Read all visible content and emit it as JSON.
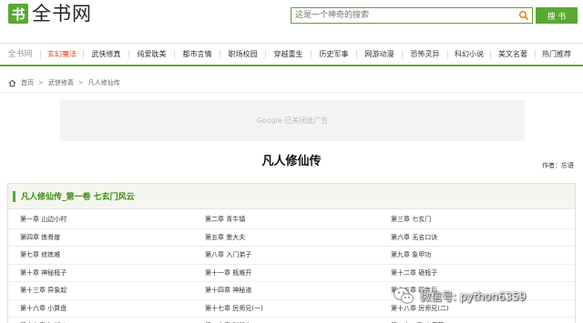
{
  "header": {
    "logo_badge": "书",
    "logo_text": "全书网",
    "search_placeholder": "这是一个神奇的搜索",
    "search_button": "搜 书"
  },
  "nav": {
    "site": "全书网",
    "items": [
      "玄幻魔法",
      "武侠修真",
      "纯爱耽美",
      "都市言情",
      "职场校园",
      "穿越重生",
      "历史军事",
      "网游动漫",
      "恐怖灵异",
      "科幻小说",
      "美文名著",
      "热门推荐"
    ],
    "active_index": 0
  },
  "breadcrumb": {
    "items": [
      "首页",
      "武侠修真",
      "凡人修仙传"
    ]
  },
  "ad": {
    "text": "Google 已关闭此广告"
  },
  "book": {
    "title": "凡人修仙传",
    "author": "作者：忘语"
  },
  "volume": {
    "title": "凡人修仙传_第一卷 七玄门风云"
  },
  "chapters": [
    [
      "第一章 山边小村",
      "第二章 青牛镇",
      "第三章 七玄门"
    ],
    [
      "第四章 炼骨崖",
      "第五章 墨大夫",
      "第六章 无名口诀"
    ],
    [
      "第七章 修炼难",
      "第八章 入门弟子",
      "第九章 象甲功"
    ],
    [
      "第十章 神秘瓶子",
      "第十一章 瓶难开",
      "第十二章 砸瓶子"
    ],
    [
      "第十三章 异象起",
      "第十四章 神秘液",
      "第十五章 四年后"
    ],
    [
      "第十六章 小算盘",
      "第十七章 厉师兄(一)",
      "第十八章 厉师兄(二)"
    ],
    [
      "第十九章 江湖斗",
      "第二十章 驯鼠丸",
      "第二十一章 止痛药"
    ]
  ],
  "watermark": {
    "text": "微信号: python6359"
  },
  "colors": {
    "accent": "#5aa832",
    "active_nav": "#e0451b",
    "volume_title": "#3d8a14"
  }
}
